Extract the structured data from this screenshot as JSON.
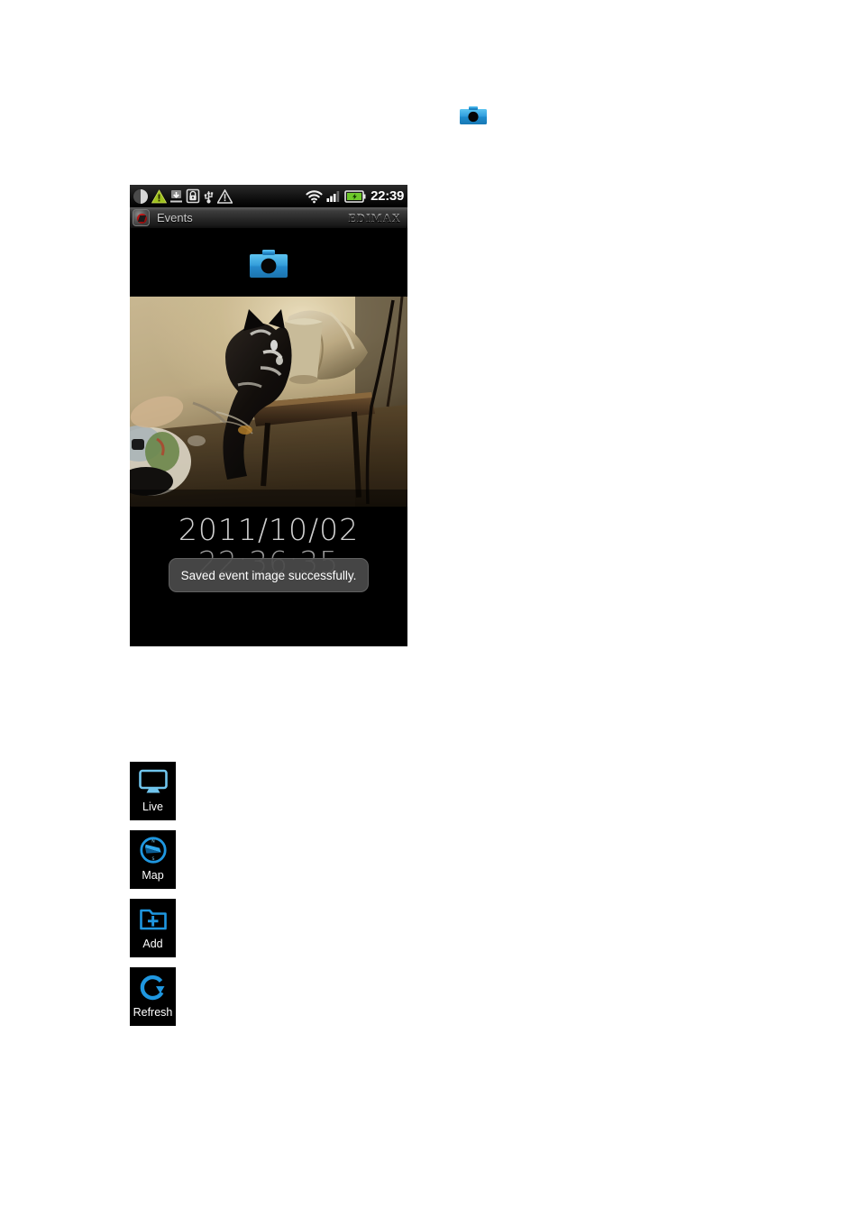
{
  "document": {
    "inline_icon": {
      "name": "camera-icon",
      "color": "#2196d9"
    }
  },
  "phone": {
    "status_bar": {
      "icons": [
        {
          "name": "vibrate-mode-icon",
          "label": "vibrate"
        },
        {
          "name": "warning-triangle-icon",
          "label": "warning"
        },
        {
          "name": "download-icon",
          "label": "download"
        },
        {
          "name": "sd-card-lock-icon",
          "label": "sd-lock"
        },
        {
          "name": "usb-icon",
          "label": "usb"
        },
        {
          "name": "alert-triangle-icon",
          "label": "alert"
        }
      ],
      "wifi": "wifi-icon",
      "signal": "signal-bars-icon",
      "battery": "battery-charging-icon",
      "battery_color": "#6ec92b",
      "clock": "22:39"
    },
    "title_bar": {
      "app_icon": "app-logo-icon",
      "title": "Events",
      "brand": "EDIMAX"
    },
    "snapshot": {
      "button_name": "snapshot-camera-button",
      "color": "#2f9ddd"
    },
    "event": {
      "date": "2011/10/02",
      "time": "22:36:35"
    },
    "toast": {
      "message": "Saved event image successfully."
    }
  },
  "legend": {
    "items": [
      {
        "label": "Live",
        "icon": "monitor-icon",
        "color": "#6fc4ec"
      },
      {
        "label": "Map",
        "icon": "compass-icon",
        "color": "#1f97e0"
      },
      {
        "label": "Add",
        "icon": "folder-add-icon",
        "color": "#1f97e0"
      },
      {
        "label": "Refresh",
        "icon": "refresh-icon",
        "color": "#1f97e0"
      }
    ]
  }
}
